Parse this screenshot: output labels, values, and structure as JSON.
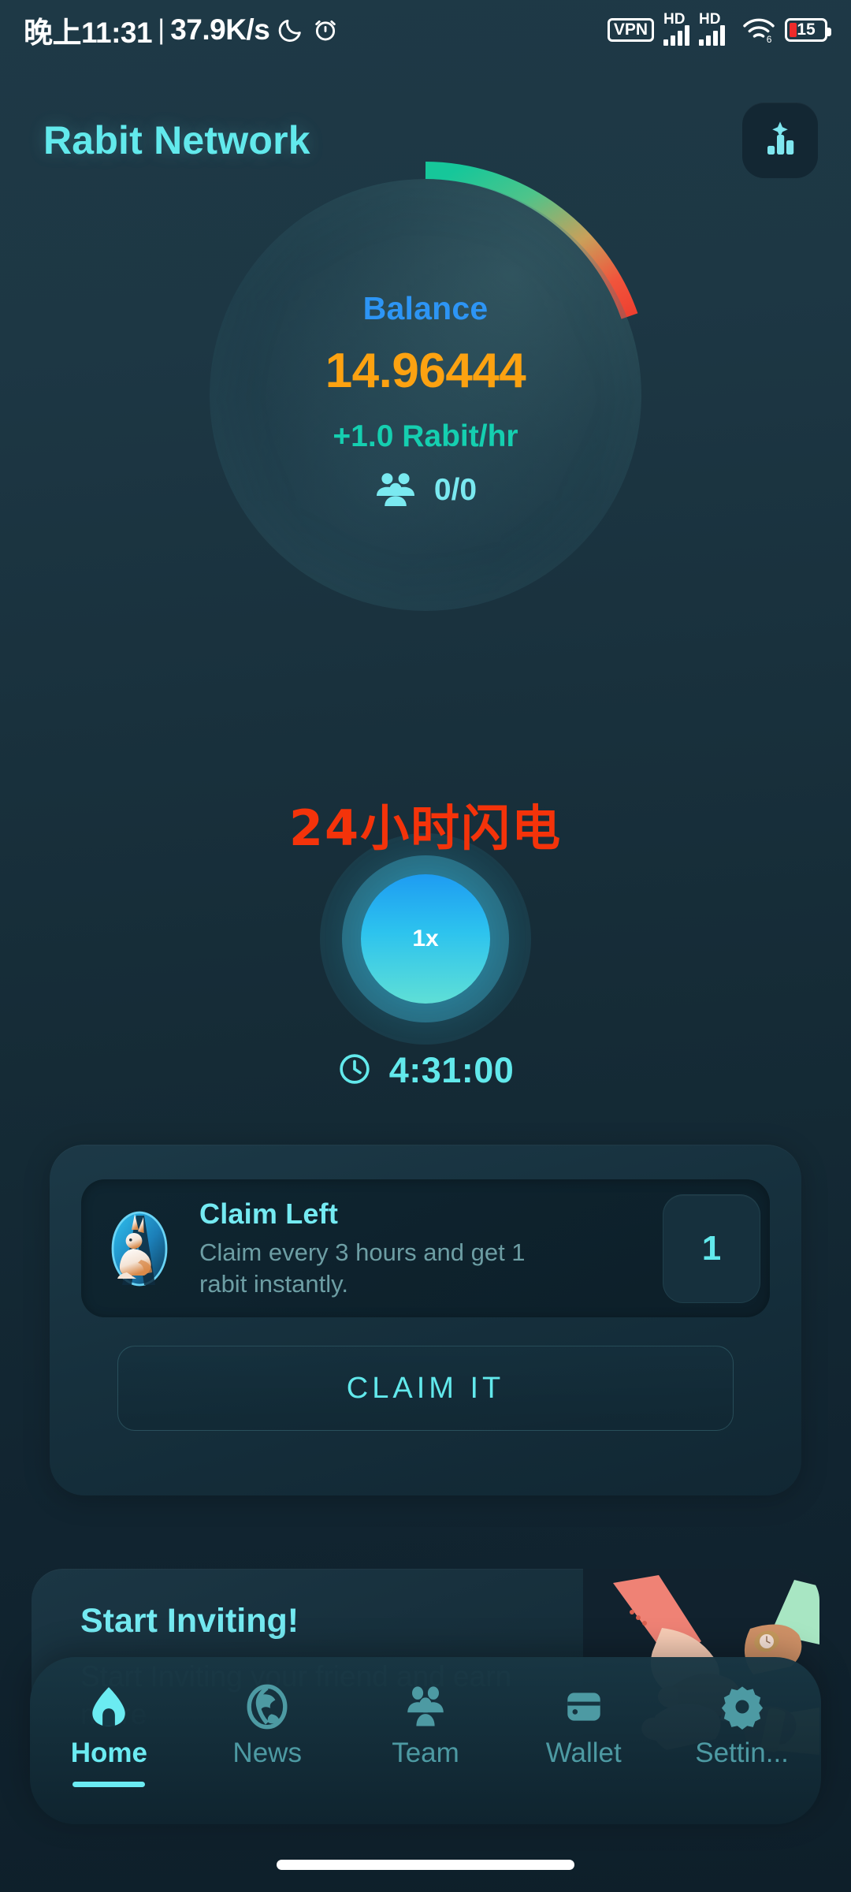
{
  "status_bar": {
    "time": "晚上11:31",
    "separator": "|",
    "network_speed": "37.9K/s",
    "moon_icon": "moon-icon",
    "alarm_icon": "alarm-icon",
    "vpn_label": "VPN",
    "hd_label_1": "HD",
    "hd_label_2": "HD",
    "wifi_icon": "wifi-6-icon",
    "battery_percent": "15"
  },
  "header": {
    "title": "Rabit Network",
    "stats_button_icon": "bar-chart-sparkle-icon",
    "title_color": "#62e9ec"
  },
  "balance_orb": {
    "label": "Balance",
    "label_color": "#2d95f5",
    "value": "14.96444",
    "value_color": "#fca211",
    "rate": "+1.0 Rabit/hr",
    "rate_color": "#15cfb0",
    "team_icon": "group-people-icon",
    "team_count": "0/0",
    "team_count_color": "#7ae9f0",
    "arc_progress_percent": 8,
    "arc_colors": [
      "#16c79a",
      "#3cc98a",
      "#c8a35a",
      "#f0553c",
      "#ef4b3a"
    ]
  },
  "promo": {
    "text": "24小时闪电",
    "color": "#f4330a"
  },
  "multiplier": {
    "label": "1x",
    "core_gradient_from": "#1e9cf2",
    "core_gradient_to": "#5fdfd6"
  },
  "timer": {
    "clock_icon": "clock-icon",
    "value": "4:31:00",
    "color": "#62e9ec"
  },
  "claim_card": {
    "logo_icon": "rabbit-logo-icon",
    "title": "Claim Left",
    "description": "Claim every 3 hours and get 1 rabit instantly.",
    "badge_count": "1",
    "button_label": "CLAIM IT"
  },
  "invite_card": {
    "title": "Start Inviting!",
    "subtitle": "Start Inviting your friend and earn more",
    "illustration_icon": "teamwork-hands-illustration"
  },
  "bottom_nav": {
    "items": [
      {
        "label": "Home",
        "icon": "home-icon",
        "active": true
      },
      {
        "label": "News",
        "icon": "globe-icon",
        "active": false
      },
      {
        "label": "Team",
        "icon": "group-people-icon",
        "active": false
      },
      {
        "label": "Wallet",
        "icon": "wallet-icon",
        "active": false
      },
      {
        "label": "Settin...",
        "icon": "gear-icon",
        "active": false
      }
    ],
    "active_color": "#6bebf2",
    "inactive_color": "#4d9aa3"
  }
}
